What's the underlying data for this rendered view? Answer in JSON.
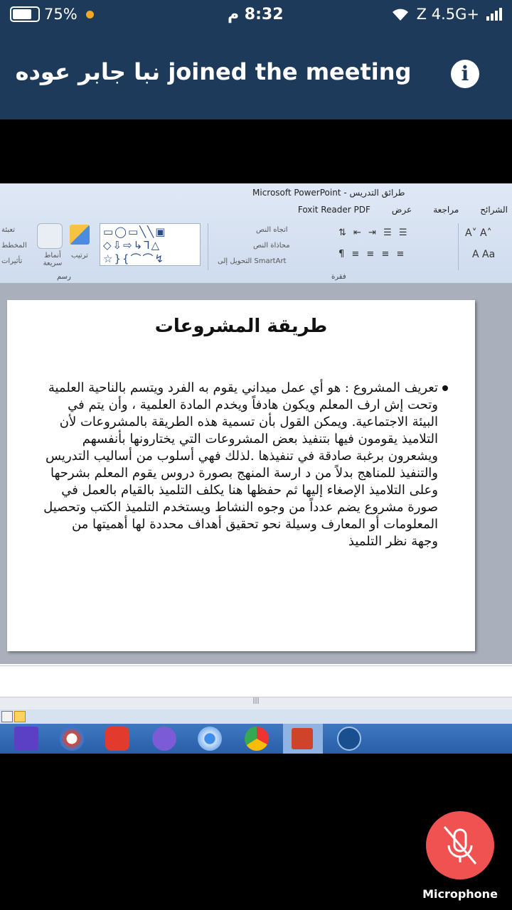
{
  "status_bar": {
    "battery": "75%",
    "time": "8:32 م",
    "network": "Z 4.5G+"
  },
  "banner": {
    "text": "نبا جابر عوده joined the meeting"
  },
  "shared_screen": {
    "window_title": "Microsoft PowerPoint - طرائق التدريس",
    "tabs": [
      "الشرائح",
      "مراجعة",
      "عرض",
      "Foxit Reader PDF"
    ],
    "ribbon": {
      "arrange": "ترتيب",
      "quick_styles": "أنماط سريعة",
      "drawing_group": "رسم",
      "paragraph_group": "فقرة",
      "text_direction": "اتجاه النص",
      "align_text": "محاذاة النص",
      "smartart": "التحويل إلى SmartArt",
      "fill": "تعبئة",
      "outline": "المخطط",
      "effects": "تأثيرات"
    },
    "slide": {
      "title": "طريقة المشروعات",
      "body": "تعريف المشروع : هو أي عمل ميداني يقوم به الفرد ويتسم بالناحية العلمية وتحت إش ارف المعلم ويكون هادفاً ويخدم المادة العلمية ، وأن يتم في البيئة الاجتماعية. ويمكن القول بأن تسمية هذه الطريقة بالمشروعات لأن التلاميذ يقومون فيها بتنفيذ بعض المشروعات التي يختارونها بأنفسهم ويشعرون برغبة صادقة في تنفيذها .لذلك فهي أسلوب من أساليب التدريس والتنفيذ للمناهج بدلاً من د ارسة المنهج بصورة دروس يقوم المعلم بشرحها وعلى التلاميذ الإصغاء إليها ثم حفظها هنا يكلف التلميذ بالقيام بالعمل في صورة مشروع يضم عدداً من وجوه النشاط ويستخدم التلميذ الكتب وتحصيل المعلومات أو المعارف وسيلة نحو تحقيق أهداف محددة لها أهميتها من وجهة نظر التلميذ"
    }
  },
  "controls": {
    "microphone_label": "Microphone"
  },
  "colors": {
    "header_bg": "#1e3a5a",
    "mic_bg": "#f05252",
    "taskbar": "#2a5ea8"
  }
}
